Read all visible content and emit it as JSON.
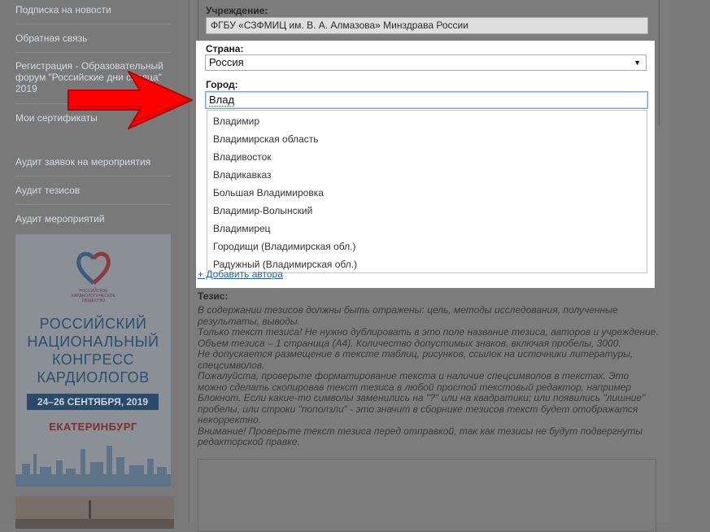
{
  "sidebar": {
    "items": [
      {
        "label": "Подписка на новости"
      },
      {
        "label": "Обратная связь"
      },
      {
        "label": "Регистрация - Образовательный форум \"Российские дни сердца\" 2019"
      },
      {
        "label": "Мои сертификаты"
      },
      {
        "label": "Аудит заявок на мероприятия"
      },
      {
        "label": "Аудит тезисов"
      },
      {
        "label": "Аудит мероприятий"
      }
    ],
    "banner": {
      "society": "РОССИЙСКОЕ КАРДИОЛОГИЧЕСКОЕ ОБЩЕСТВО",
      "title_lines": [
        "РОССИЙСКИЙ",
        "НАЦИОНАЛЬНЫЙ",
        "КОНГРЕСС",
        "КАРДИОЛОГОВ"
      ],
      "dates": "24–26 СЕНТЯБРЯ, 2019",
      "city": "ЕКАТЕРИНБУРГ"
    }
  },
  "form": {
    "institution_label": "Учреждение:",
    "institution_value": "ФГБУ «СЗФМИЦ им. В. А. Алмазова» Минздрава России",
    "country_label": "Страна:",
    "country_value": "Россия",
    "city_label": "Город:",
    "city_value": "Влад",
    "city_suggestions": [
      "Владимир",
      "Владимирская область",
      "Владивосток",
      "Владикавказ",
      "Большая Владимировка",
      "Владимир-Волынский",
      "Владимирец",
      "Городищи (Владимирская обл.)",
      "Радужный (Владимирская обл.)"
    ],
    "add_author_link": "+ Добавить автора"
  },
  "tezis": {
    "label": "Тезис:",
    "lines": [
      "В содержании тезисов должны быть отражены: цель, методы исследования, полученные",
      "результаты, выводы.",
      "Только текст тезиса! Не нужно дублировать в это поле название тезиса, авторов и учреждение.",
      "Объем тезиса – 1 страница (А4). Количество допустимых знаков, включая пробелы, 3000.",
      "Не допускается размещение в тексте таблиц, рисунков, ссылок на источники литературы,",
      "спецсимволов.",
      "Пожалуйста, проверьте форматирование текста и наличие спецсимволов в текстах. Это",
      "можно сделать скопировав текст тезиса в любой простой текстовый редактор, например",
      "Блокнот. Если какие-то символы заменились на \"?\" или на квадратики; или появились \"лишние\"",
      "пробелы, или строки \"поползли\" - это значит в сборнике тезисов текст будет отображатся",
      "некорректно.",
      "Внимание! Проверьте текст тезиса перед отправкой, так как тезисы не будут подвергнуты",
      "редакторской правке."
    ]
  },
  "colors": {
    "overlay": "#7a7a7a",
    "highlight": "#ffffff",
    "arrow_red": "#ff0000",
    "focus_border": "#7aa7d8",
    "link": "#2b5fa5"
  }
}
